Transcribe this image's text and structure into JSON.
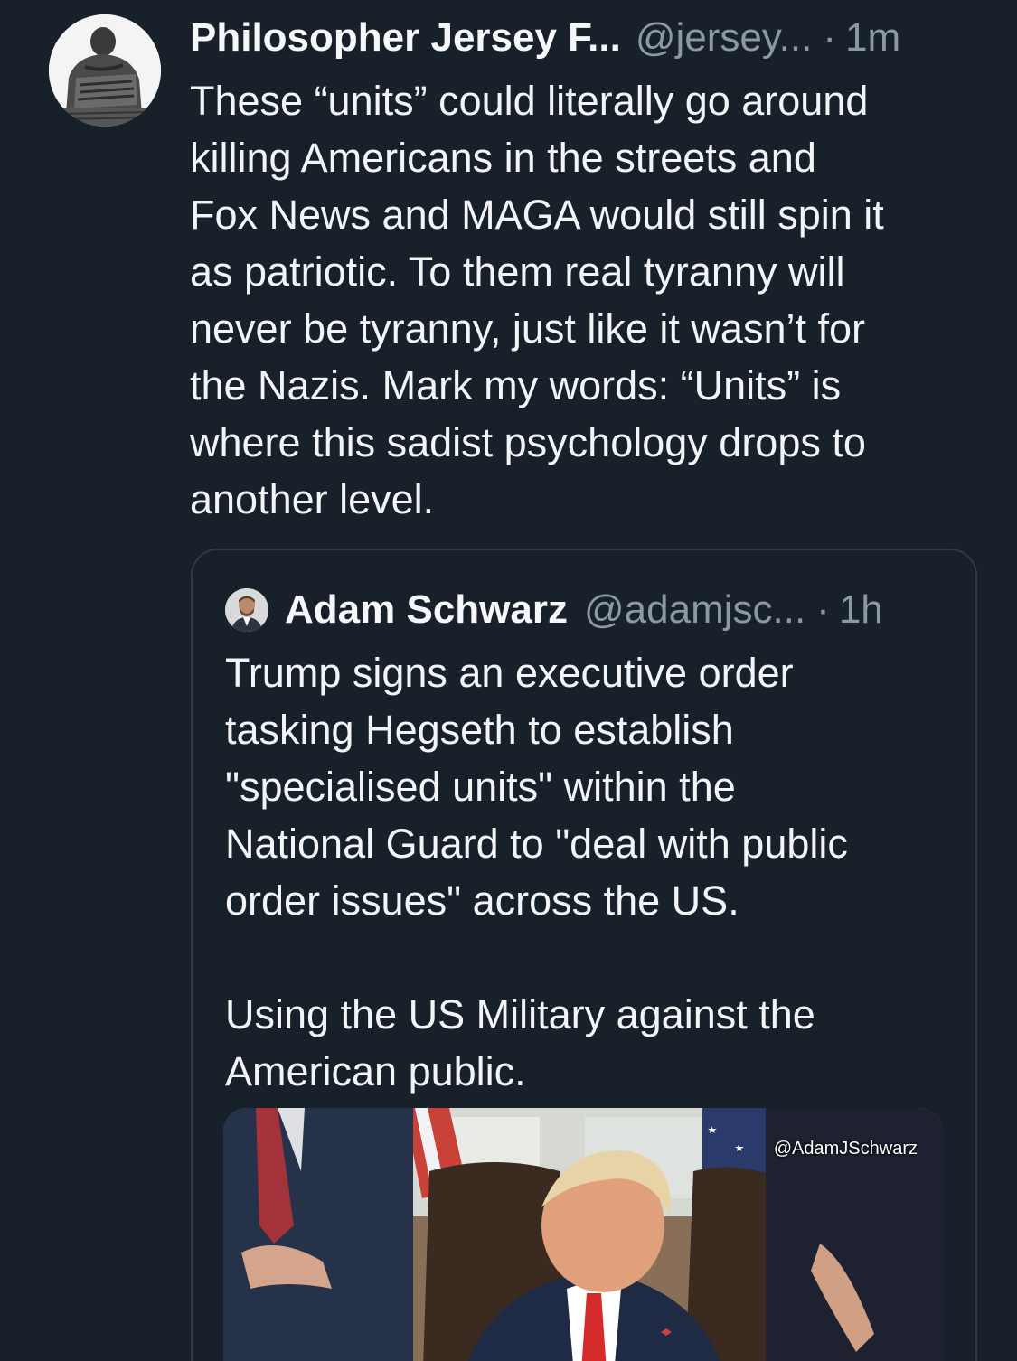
{
  "tweet": {
    "author_name": "Philosopher Jersey F...",
    "author_handle": "@jersey...",
    "separator": "·",
    "timestamp": "1m",
    "body_lines": [
      "These “units” could literally go around",
      "killing Americans in the streets and",
      "Fox News and MAGA would still spin it",
      "as patriotic. To them real tyranny will",
      "never be tyranny, just like it wasn’t for",
      "the Nazis. Mark my words: “Units” is",
      "where this sadist psychology drops to",
      "another level."
    ]
  },
  "quoted_tweet": {
    "author_name": "Adam Schwarz",
    "author_handle": "@adamjsc...",
    "separator": "·",
    "timestamp": "1h",
    "body_lines": [
      "Trump signs an executive order",
      "tasking Hegseth to establish",
      "\"specialised units\" within the",
      "National Guard to \"deal with public",
      "order issues\" across the US."
    ],
    "body_lines_2": [
      "Using the US Military against the",
      "American public."
    ],
    "media": {
      "watermark": "@AdamJSchwarz"
    }
  },
  "colors": {
    "background": "#18202a",
    "text_primary": "#f2f4f6",
    "text_secondary": "#8b98a5",
    "border": "#2f3a45"
  }
}
